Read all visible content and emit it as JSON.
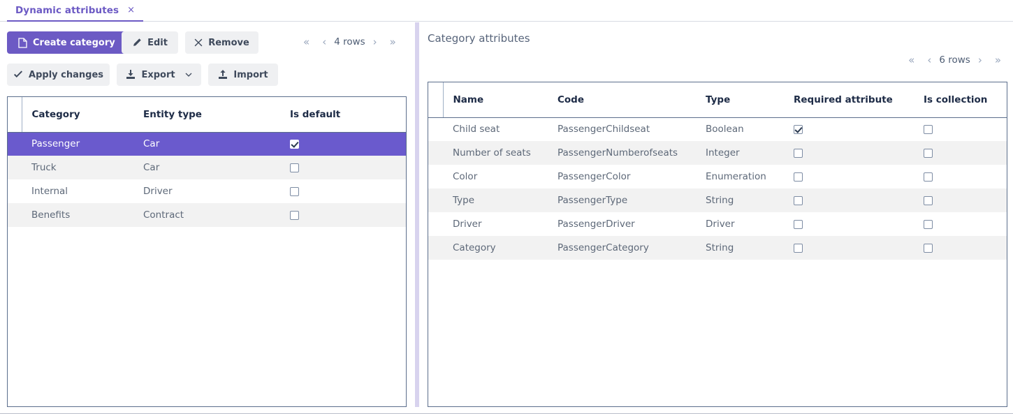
{
  "tab": {
    "label": "Dynamic attributes",
    "close_icon": "close-icon",
    "close_glyph": "×"
  },
  "toolbar": {
    "create_category": "Create category",
    "edit": "Edit",
    "remove": "Remove",
    "apply_changes": "Apply changes",
    "export": "Export",
    "import": "Import",
    "icons": {
      "create": "file-icon",
      "edit": "pencil-icon",
      "remove": "cross-icon",
      "apply": "check-icon",
      "export": "download-icon",
      "export_chevron": "chevron-down-icon",
      "import": "upload-icon"
    }
  },
  "left_pager": {
    "first": "«",
    "prev": "‹",
    "rows": "4 rows",
    "next": "›",
    "last": "»"
  },
  "right_pager": {
    "first": "«",
    "prev": "‹",
    "rows": "6 rows",
    "next": "›",
    "last": "»"
  },
  "categories_grid": {
    "columns": [
      "Category",
      "Entity type",
      "Is default"
    ],
    "rows": [
      {
        "category": "Passenger",
        "entity_type": "Car",
        "is_default": true,
        "selected": true
      },
      {
        "category": "Truck",
        "entity_type": "Car",
        "is_default": false,
        "selected": false
      },
      {
        "category": "Internal",
        "entity_type": "Driver",
        "is_default": false,
        "selected": false
      },
      {
        "category": "Benefits",
        "entity_type": "Contract",
        "is_default": false,
        "selected": false
      }
    ]
  },
  "attributes_panel": {
    "title": "Category attributes",
    "columns": [
      "Name",
      "Code",
      "Type",
      "Required attribute",
      "Is collection"
    ],
    "rows": [
      {
        "name": "Child seat",
        "code": "PassengerChildseat",
        "type": "Boolean",
        "required": true,
        "collection": false
      },
      {
        "name": "Number of seats",
        "code": "PassengerNumberofseats",
        "type": "Integer",
        "required": false,
        "collection": false
      },
      {
        "name": "Color",
        "code": "PassengerColor",
        "type": "Enumeration",
        "required": false,
        "collection": false
      },
      {
        "name": "Type",
        "code": "PassengerType",
        "type": "String",
        "required": false,
        "collection": false
      },
      {
        "name": "Driver",
        "code": "PassengerDriver",
        "type": "Driver",
        "required": false,
        "collection": false
      },
      {
        "name": "Category",
        "code": "PassengerCategory",
        "type": "String",
        "required": false,
        "collection": false
      }
    ]
  },
  "colors": {
    "accent_purple": "#6c5ac4",
    "selected_row": "#6a5acd",
    "splitter": "#d8d3ee",
    "grid_border": "#5b6e8c",
    "zebra": "#f2f2f2",
    "button_bg": "#eff0f2",
    "text": "#5d6878"
  }
}
